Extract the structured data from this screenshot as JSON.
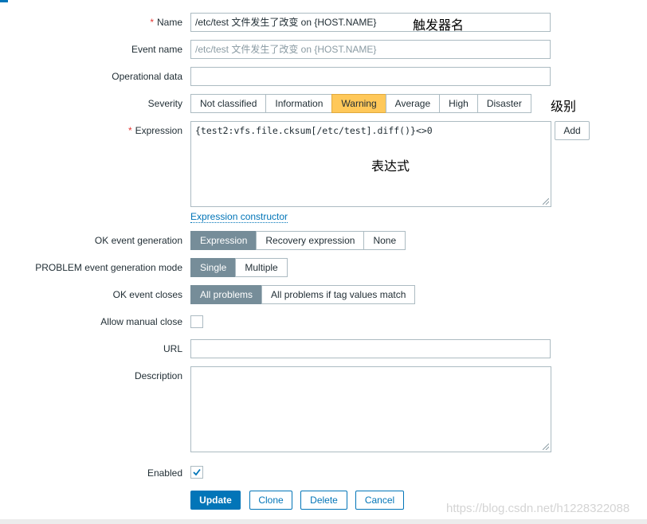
{
  "form": {
    "name": {
      "label": "Name",
      "required_mark": "*",
      "value": "/etc/test 文件发生了改变 on {HOST.NAME}"
    },
    "event_name": {
      "label": "Event name",
      "placeholder": "/etc/test 文件发生了改变 on {HOST.NAME}"
    },
    "operational_data": {
      "label": "Operational data",
      "value": ""
    },
    "severity": {
      "label": "Severity",
      "options": [
        "Not classified",
        "Information",
        "Warning",
        "Average",
        "High",
        "Disaster"
      ],
      "selected": "Warning",
      "selected_color": "#ffc859"
    },
    "expression": {
      "label": "Expression",
      "required_mark": "*",
      "value": "{test2:vfs.file.cksum[/etc/test].diff()}<>0",
      "add_label": "Add",
      "constructor_link": "Expression constructor"
    },
    "ok_event_generation": {
      "label": "OK event generation",
      "options": [
        "Expression",
        "Recovery expression",
        "None"
      ],
      "selected": "Expression"
    },
    "problem_event_mode": {
      "label": "PROBLEM event generation mode",
      "options": [
        "Single",
        "Multiple"
      ],
      "selected": "Single"
    },
    "ok_event_closes": {
      "label": "OK event closes",
      "options": [
        "All problems",
        "All problems if tag values match"
      ],
      "selected": "All problems"
    },
    "allow_manual_close": {
      "label": "Allow manual close",
      "checked": false
    },
    "url": {
      "label": "URL",
      "value": ""
    },
    "description": {
      "label": "Description",
      "value": ""
    },
    "enabled": {
      "label": "Enabled",
      "checked": true
    },
    "buttons": {
      "update": "Update",
      "clone": "Clone",
      "delete": "Delete",
      "cancel": "Cancel"
    }
  },
  "annotations": {
    "name_note": "触发器名",
    "severity_note": "级别",
    "expression_note": "表达式"
  },
  "watermark": "https://blog.csdn.net/h1228322088",
  "colors": {
    "accent": "#0275b8",
    "selected_segment": "#768d99",
    "warning": "#ffc859",
    "required": "#e33734"
  }
}
